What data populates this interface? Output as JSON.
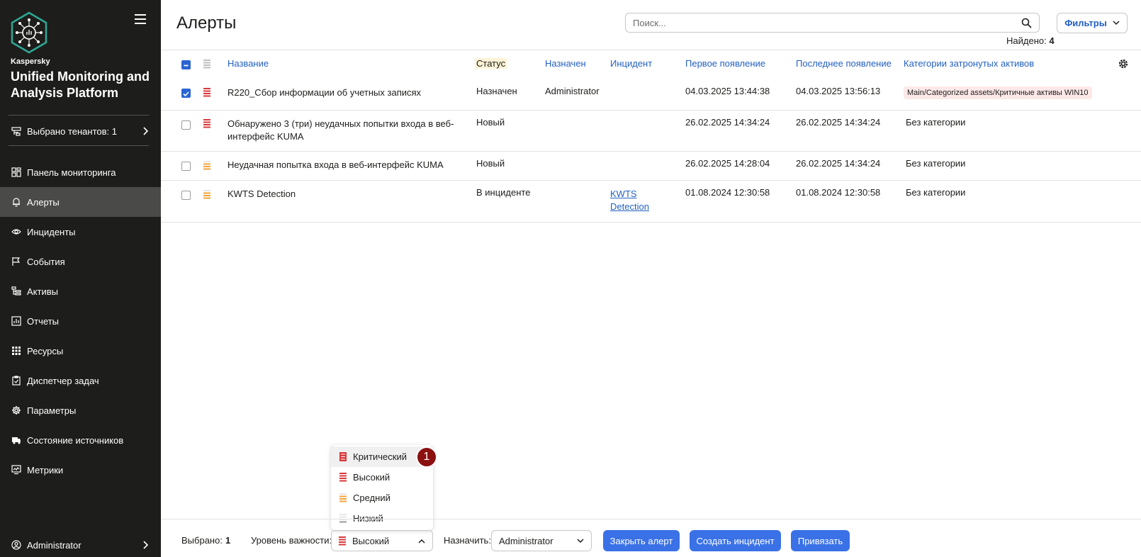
{
  "sidebar": {
    "brand_small": "Kaspersky",
    "brand_big": "Unified Monitoring and Analysis Platform",
    "tenant": "Выбрано тенантов: 1",
    "items": [
      {
        "label": "Панель мониторинга",
        "icon": "dashboard-icon"
      },
      {
        "label": "Алерты",
        "icon": "bell-icon"
      },
      {
        "label": "Инциденты",
        "icon": "eye-icon"
      },
      {
        "label": "События",
        "icon": "flag-icon"
      },
      {
        "label": "Активы",
        "icon": "tree-icon"
      },
      {
        "label": "Отчеты",
        "icon": "report-icon"
      },
      {
        "label": "Ресурсы",
        "icon": "grid-icon"
      },
      {
        "label": "Диспетчер задач",
        "icon": "clipboard-icon"
      },
      {
        "label": "Параметры",
        "icon": "gear-icon"
      },
      {
        "label": "Состояние источников",
        "icon": "truck-icon"
      },
      {
        "label": "Метрики",
        "icon": "monitor-icon"
      }
    ],
    "user": "Administrator"
  },
  "header": {
    "title": "Алерты",
    "search_placeholder": "Поиск...",
    "filters_label": "Фильтры",
    "found_label": "Найдено:",
    "found_count": "4"
  },
  "table": {
    "columns": [
      "Название",
      "Статус",
      "Назначен",
      "Инцидент",
      "Первое появление",
      "Последнее появление",
      "Категории затронутых активов"
    ],
    "rows": [
      {
        "checked": true,
        "severity": "Высокий",
        "name": "R220_Сбор информации об учетных записях",
        "status": "Назначен",
        "assigned": "Administrator",
        "incident": "",
        "first": "04.03.2025 13:44:38",
        "last": "04.03.2025 13:56:13",
        "category": "Main/Categorized assets/Критичные активы WIN10"
      },
      {
        "checked": false,
        "severity": "Высокий",
        "name": "Обнаружено 3 (три) неудачных попытки входа в веб-интерфейс KUMA",
        "status": "Новый",
        "assigned": "",
        "incident": "",
        "first": "26.02.2025 14:34:24",
        "last": "26.02.2025 14:34:24",
        "category": "Без категории"
      },
      {
        "checked": false,
        "severity": "Средний",
        "name": "Неудачная попытка входа в веб-интерфейс KUMA",
        "status": "Новый",
        "assigned": "",
        "incident": "",
        "first": "26.02.2025 14:28:04",
        "last": "26.02.2025 14:34:24",
        "category": "Без категории"
      },
      {
        "checked": false,
        "severity": "Средний",
        "name": "KWTS Detection",
        "status": "В инциденте",
        "assigned": "",
        "incident": "KWTS Detection",
        "first": "01.08.2024 12:30:58",
        "last": "01.08.2024 12:30:58",
        "category": "Без категории"
      }
    ]
  },
  "severity_dropdown": {
    "options": [
      "Критический",
      "Высокий",
      "Средний",
      "Низкий"
    ],
    "highlighted": "Критический",
    "step_badge": "1"
  },
  "footer": {
    "selected_label": "Выбрано:",
    "selected_count": "1",
    "severity_label": "Уровень важности:",
    "severity_value": "Высокий",
    "assign_label": "Назначить:",
    "assign_value": "Administrator",
    "close_alert": "Закрыть алерт",
    "create_incident": "Создать инцидент",
    "link": "Привязать"
  },
  "colors": {
    "sidebar_bg": "#1d1d1b",
    "accent": "#3a71e6",
    "link": "#2360c2",
    "critical": "#d9393b",
    "medium": "#f1a43a",
    "low": "#bdbdbd",
    "badge": "#8b1010"
  }
}
